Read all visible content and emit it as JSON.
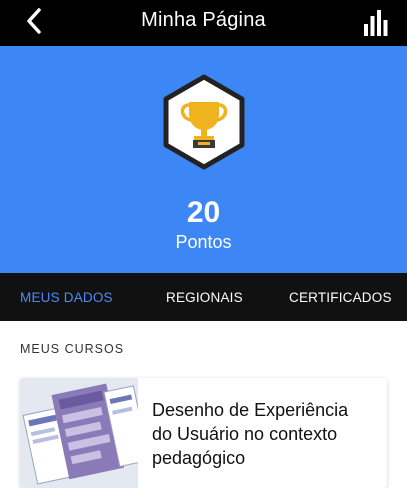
{
  "header": {
    "title": "Minha Página",
    "back_icon": "chevron-left-icon",
    "stats_icon": "bar-chart-icon"
  },
  "hero": {
    "badge_icon": "trophy-icon",
    "points_value": "20",
    "points_label": "Pontos",
    "background_color": "#3d86f5"
  },
  "tabs": [
    {
      "label": "MEUS DADOS",
      "active": true
    },
    {
      "label": "REGIONAIS",
      "active": false
    },
    {
      "label": "CERTIFICADOS",
      "active": false
    }
  ],
  "courses_section": {
    "title": "MEUS CURSOS",
    "courses": [
      {
        "title": "Desenho de Experiência do Usuário no contexto pedagógico"
      }
    ]
  }
}
